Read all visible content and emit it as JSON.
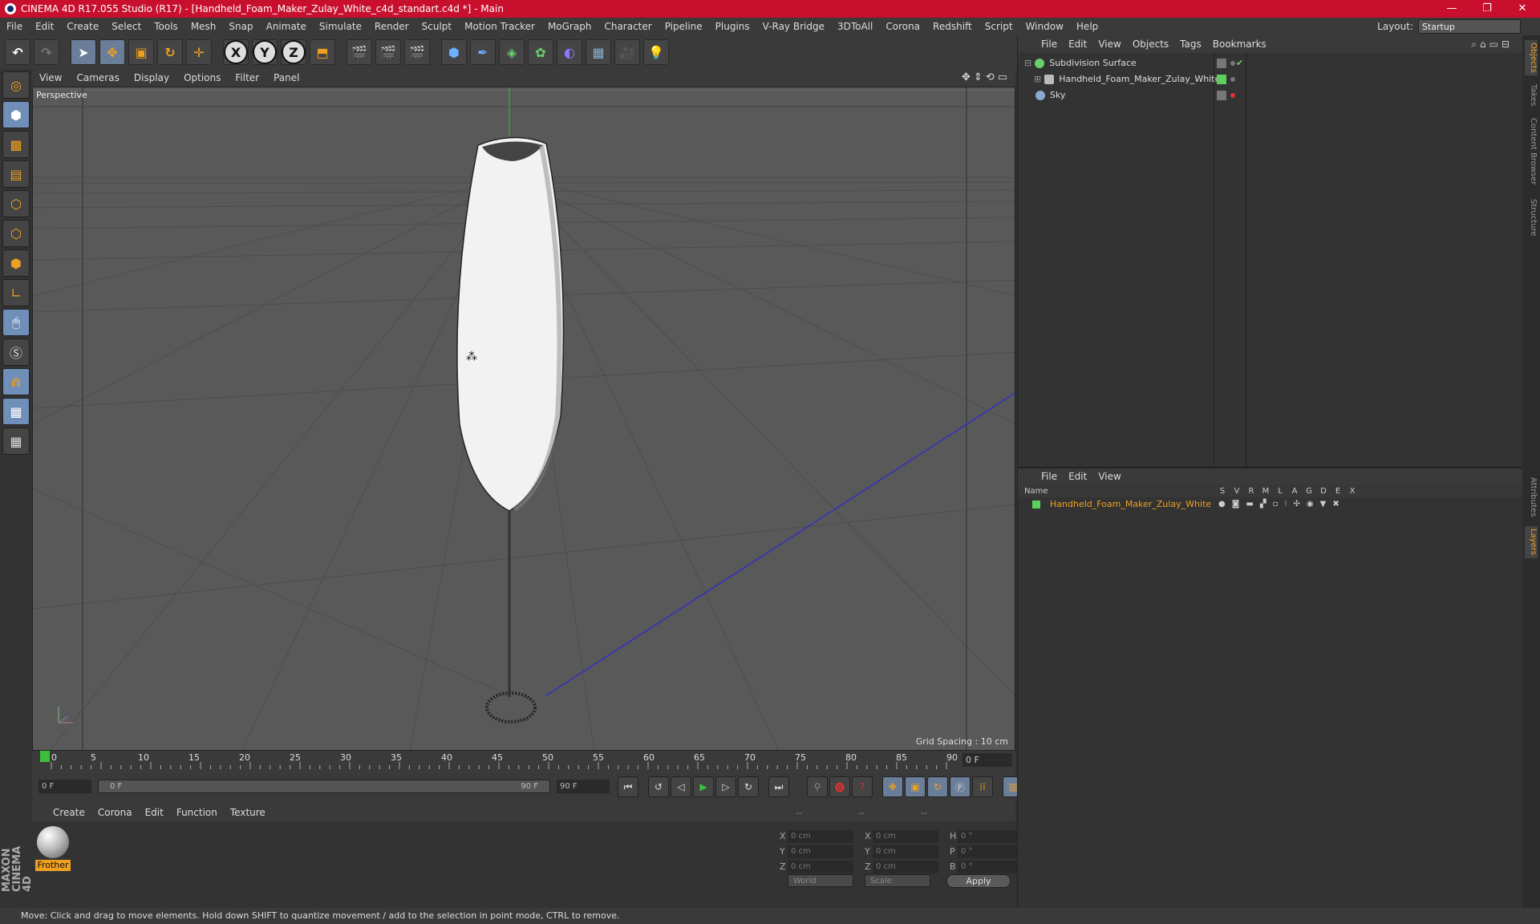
{
  "window": {
    "title": "CINEMA 4D R17.055 Studio (R17) - [Handheld_Foam_Maker_Zulay_White_c4d_standart.c4d *] - Main",
    "controls": [
      "—",
      "❐",
      "✕"
    ]
  },
  "menubar": {
    "items": [
      "File",
      "Edit",
      "Create",
      "Select",
      "Tools",
      "Mesh",
      "Snap",
      "Animate",
      "Simulate",
      "Render",
      "Sculpt",
      "Motion Tracker",
      "MoGraph",
      "Character",
      "Pipeline",
      "Plugins",
      "V-Ray Bridge",
      "3DToAll",
      "Corona",
      "Redshift",
      "Script",
      "Window",
      "Help"
    ],
    "layout_label": "Layout:",
    "layout_value": "Startup"
  },
  "viewport": {
    "menu": [
      "View",
      "Cameras",
      "Display",
      "Options",
      "Filter",
      "Panel"
    ],
    "label": "Perspective",
    "grid_spacing": "Grid Spacing : 10 cm"
  },
  "timeline": {
    "ticks": [
      "0",
      "5",
      "10",
      "15",
      "20",
      "25",
      "30",
      "35",
      "40",
      "45",
      "50",
      "55",
      "60",
      "65",
      "70",
      "75",
      "80",
      "85",
      "90"
    ],
    "current_frame": "0 F"
  },
  "transport": {
    "start_field": "0 F",
    "slider_start": "0 F",
    "slider_end": "90 F",
    "end_field": "90 F"
  },
  "materials": {
    "menu": [
      "Create",
      "Corona",
      "Edit",
      "Function",
      "Texture"
    ],
    "items": [
      {
        "name": "Frother"
      }
    ]
  },
  "coords": {
    "headers": [
      "--",
      "--",
      "--"
    ],
    "rows": [
      {
        "a": "X",
        "av": "0 cm",
        "b": "X",
        "bv": "0 cm",
        "c": "H",
        "cv": "0 °"
      },
      {
        "a": "Y",
        "av": "0 cm",
        "b": "Y",
        "bv": "0 cm",
        "c": "P",
        "cv": "0 °"
      },
      {
        "a": "Z",
        "av": "0 cm",
        "b": "Z",
        "bv": "0 cm",
        "c": "B",
        "cv": "0 °"
      }
    ],
    "mode1": "World",
    "mode2": "Scale",
    "apply": "Apply"
  },
  "objects": {
    "menu": [
      "File",
      "Edit",
      "View",
      "Objects",
      "Tags",
      "Bookmarks"
    ],
    "items": [
      {
        "name": "Subdivision Surface",
        "color": "#6ad06a"
      },
      {
        "name": "Handheld_Foam_Maker_Zulay_White",
        "color": "#bbbbbb"
      },
      {
        "name": "Sky",
        "color": "#8aaad0"
      }
    ]
  },
  "layers": {
    "menu": [
      "File",
      "Edit",
      "View"
    ],
    "header_name": "Name",
    "columns": [
      "S",
      "V",
      "R",
      "M",
      "L",
      "A",
      "G",
      "D",
      "E",
      "X"
    ],
    "items": [
      {
        "name": "Handheld_Foam_Maker_Zulay_White",
        "color": "#5ad05a"
      }
    ]
  },
  "sidetabs": [
    "Objects",
    "Takes",
    "Content Browser",
    "Structure",
    "Attributes",
    "Layers"
  ],
  "status": "Move: Click and drag to move elements. Hold down SHIFT to quantize movement / add to the selection in point mode, CTRL to remove.",
  "brand": "MAXON CINEMA 4D",
  "colors": {
    "accent": "#f0a020",
    "titlebar": "#c8102e",
    "selected_tool": "#6a7e99"
  }
}
